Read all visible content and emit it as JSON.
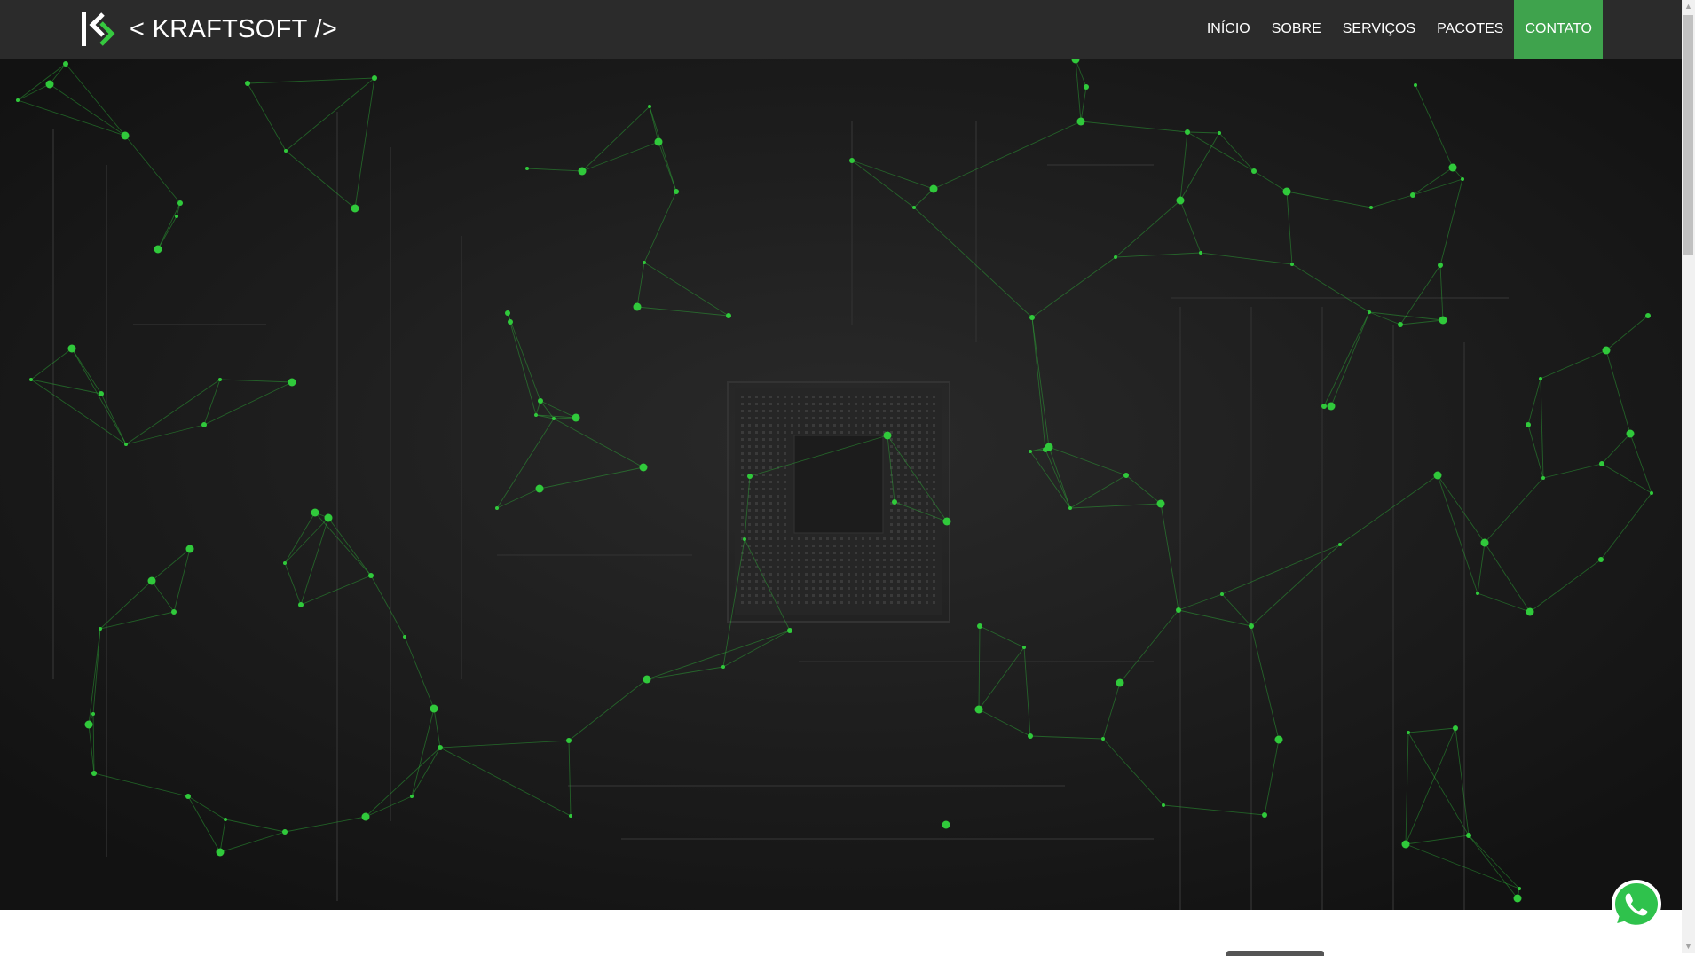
{
  "brand": {
    "name": "< KRAFTSOFT />",
    "logo_icon": "kraftsoft-k-logo-icon"
  },
  "nav": {
    "items": [
      {
        "label": "INÍCIO"
      },
      {
        "label": "SOBRE"
      },
      {
        "label": "SERVIÇOS"
      },
      {
        "label": "PACOTES"
      },
      {
        "label": "CONTATO",
        "active": true
      }
    ]
  },
  "hero": {
    "background_icon": "circuit-board-network-background"
  },
  "floating": {
    "whatsapp_icon": "whatsapp-icon"
  },
  "colors": {
    "navbar_bg": "#2b2b2b",
    "accent_green": "#3fa34d",
    "network_node": "#2ecc40",
    "hero_bg": "#141414"
  }
}
